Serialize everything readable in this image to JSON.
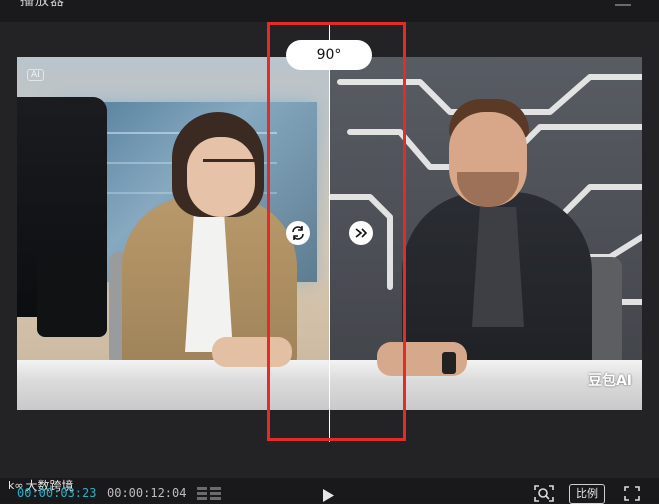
{
  "header": {
    "title": "播放器"
  },
  "preview": {
    "rotation_label": "90°",
    "corner_tag": "AI",
    "watermark": "豆包AI"
  },
  "controls": {
    "brand_label": "大数跨境",
    "current_time": "00:00:03:23",
    "total_time": "00:00:12:04",
    "ratio_label": "比例"
  },
  "colors": {
    "highlight_border": "#e52a2a",
    "current_time": "#27b2c7",
    "background": "#1b1b1d"
  }
}
